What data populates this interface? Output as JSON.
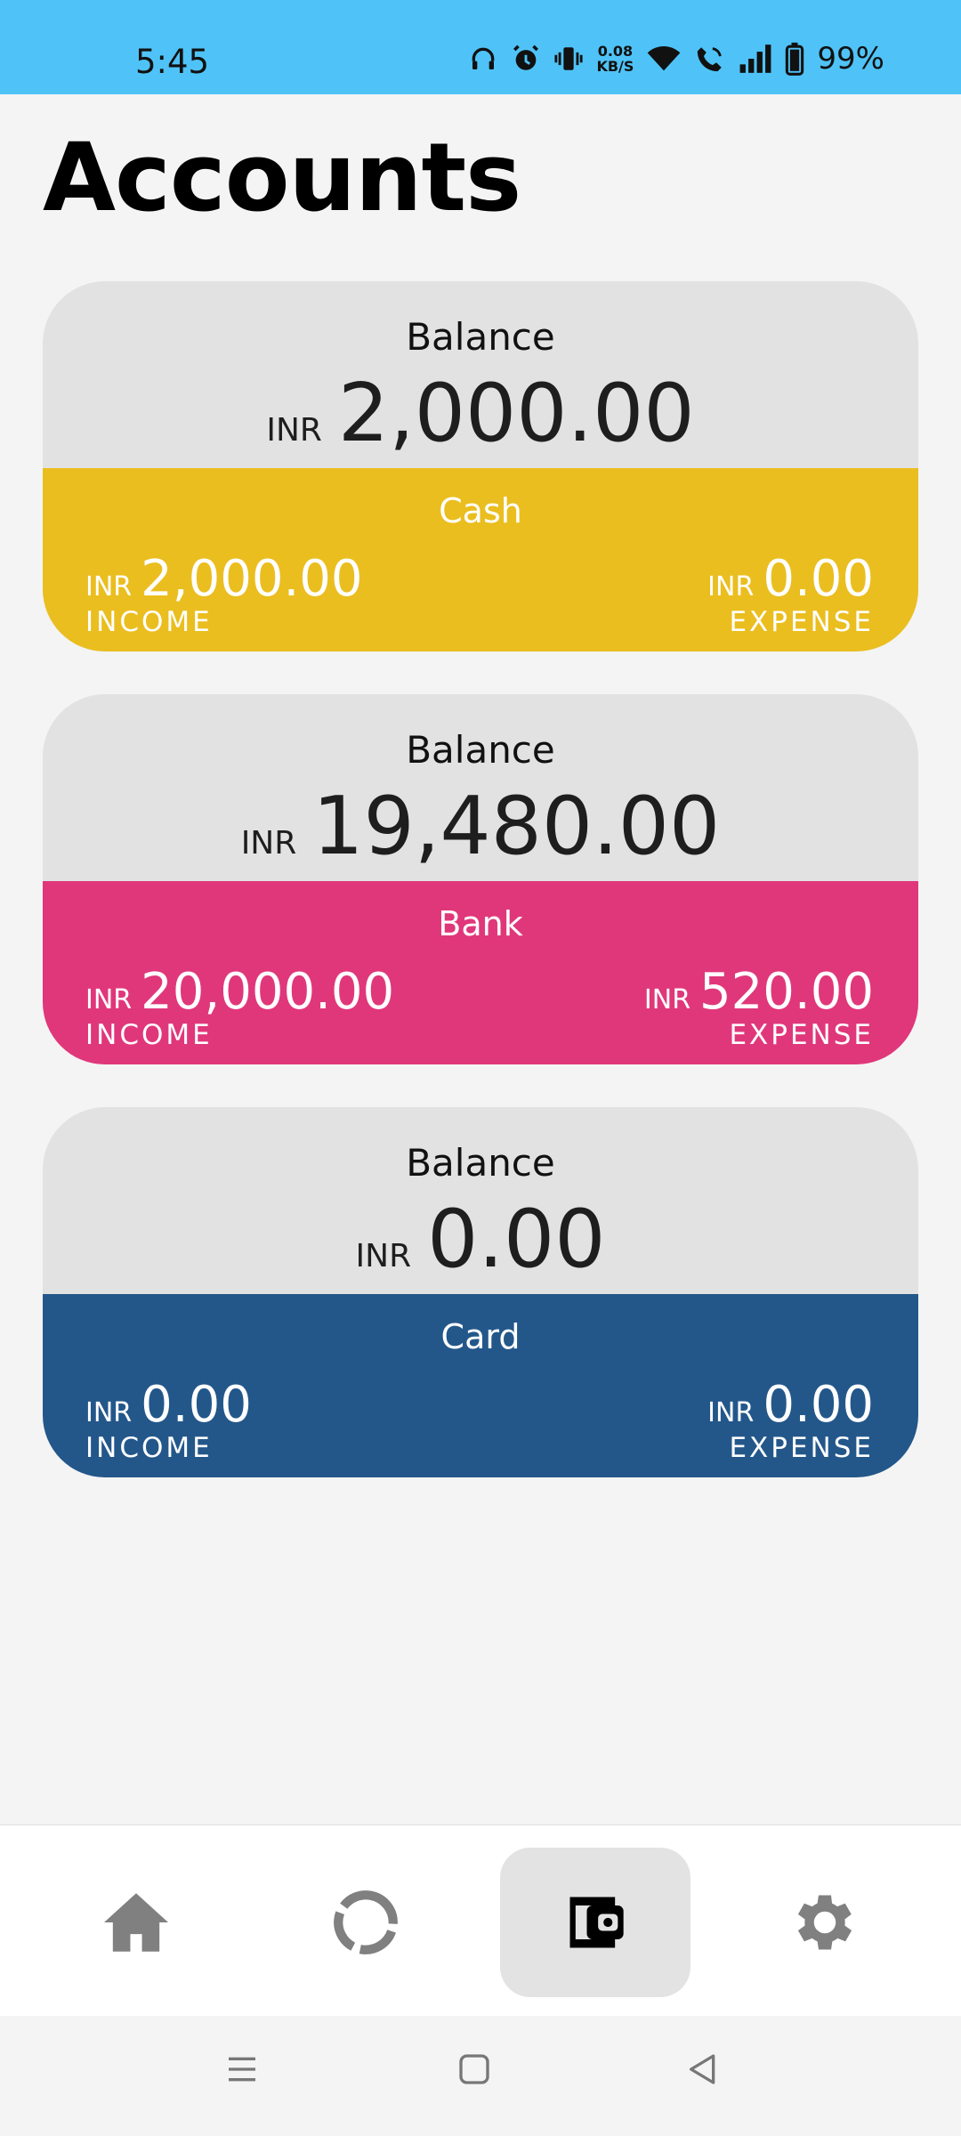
{
  "status_bar": {
    "time": "5:45",
    "net_speed_value": "0.08",
    "net_speed_unit": "KB/S",
    "battery": "99%",
    "icons": [
      "headphones-icon",
      "alarm-icon",
      "vibrate-icon",
      "wifi-icon",
      "wifi-call-icon",
      "signal-icon",
      "battery-icon"
    ]
  },
  "page": {
    "title": "Accounts"
  },
  "accounts": [
    {
      "balance_label": "Balance",
      "balance_currency": "INR",
      "balance": "2,000.00",
      "name": "Cash",
      "color": "#eabe1f",
      "income_currency": "INR",
      "income": "2,000.00",
      "income_label": "INCOME",
      "expense_currency": "INR",
      "expense": "0.00",
      "expense_label": "EXPENSE"
    },
    {
      "balance_label": "Balance",
      "balance_currency": "INR",
      "balance": "19,480.00",
      "name": "Bank",
      "color": "#e0377b",
      "income_currency": "INR",
      "income": "20,000.00",
      "income_label": "INCOME",
      "expense_currency": "INR",
      "expense": "520.00",
      "expense_label": "EXPENSE"
    },
    {
      "balance_label": "Balance",
      "balance_currency": "INR",
      "balance": "0.00",
      "name": "Card",
      "color": "#23578a",
      "income_currency": "INR",
      "income": "0.00",
      "income_label": "INCOME",
      "expense_currency": "INR",
      "expense": "0.00",
      "expense_label": "EXPENSE"
    }
  ],
  "bottom_nav": {
    "items": [
      {
        "icon": "home-icon",
        "active": false
      },
      {
        "icon": "loading-ring-icon",
        "active": false
      },
      {
        "icon": "wallet-icon",
        "active": true
      },
      {
        "icon": "gear-icon",
        "active": false
      }
    ]
  },
  "system_nav": [
    "menu-icon",
    "home-square-icon",
    "back-icon"
  ]
}
